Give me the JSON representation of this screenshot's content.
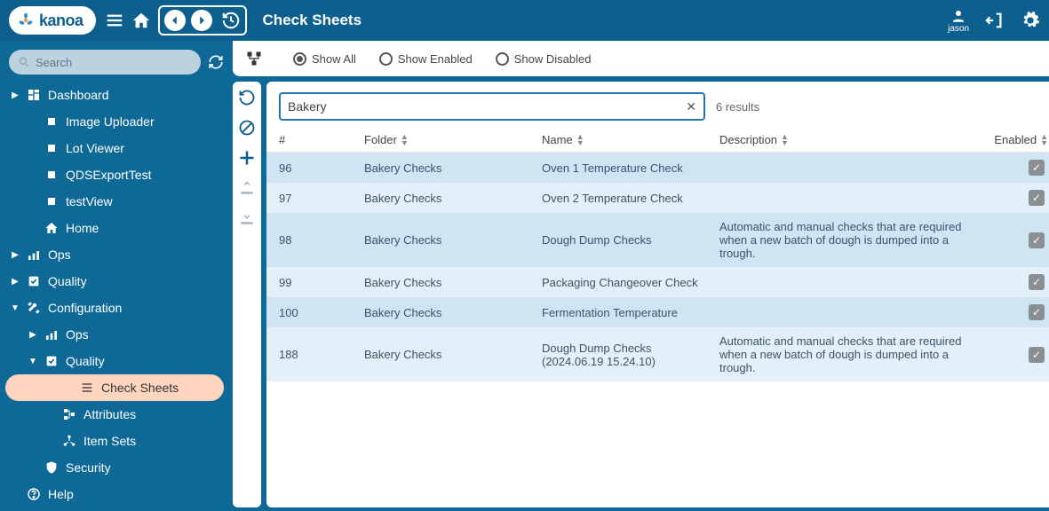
{
  "header": {
    "logo_text": "kanoa",
    "page_title": "Check Sheets",
    "user_name": "jason"
  },
  "sidebar": {
    "search_placeholder": "Search",
    "items": [
      {
        "label": "Dashboard",
        "icon": "dashboard",
        "caret": "right",
        "depth": 0
      },
      {
        "label": "Image Uploader",
        "icon": "square",
        "depth": 1
      },
      {
        "label": "Lot Viewer",
        "icon": "square",
        "depth": 1
      },
      {
        "label": "QDSExportTest",
        "icon": "square",
        "depth": 1
      },
      {
        "label": "testView",
        "icon": "square",
        "depth": 1
      },
      {
        "label": "Home",
        "icon": "home",
        "depth": 1
      },
      {
        "label": "Ops",
        "icon": "ops",
        "caret": "right",
        "depth": 0
      },
      {
        "label": "Quality",
        "icon": "quality",
        "caret": "right",
        "depth": 0
      },
      {
        "label": "Configuration",
        "icon": "tools",
        "caret": "down",
        "depth": 0
      },
      {
        "label": "Ops",
        "icon": "ops",
        "caret": "right",
        "depth": 1
      },
      {
        "label": "Quality",
        "icon": "quality",
        "caret": "down",
        "depth": 1
      },
      {
        "label": "Check Sheets",
        "icon": "checksheet",
        "depth": 2,
        "active": true
      },
      {
        "label": "Attributes",
        "icon": "attributes",
        "depth": 2
      },
      {
        "label": "Item Sets",
        "icon": "itemsets",
        "depth": 2
      },
      {
        "label": "Security",
        "icon": "security",
        "depth": 1
      },
      {
        "label": "Help",
        "icon": "help",
        "depth": 0
      }
    ]
  },
  "filterbar": {
    "options": [
      "Show All",
      "Show Enabled",
      "Show Disabled"
    ],
    "selected": 0
  },
  "panel": {
    "search_value": "Bakery",
    "results_text": "6 results",
    "columns": [
      "#",
      "Folder",
      "Name",
      "Description",
      "Enabled"
    ],
    "rows": [
      {
        "num": "96",
        "folder": "Bakery Checks",
        "name": "Oven 1 Temperature Check",
        "desc": "",
        "enabled": true
      },
      {
        "num": "97",
        "folder": "Bakery Checks",
        "name": "Oven 2 Temperature Check",
        "desc": "",
        "enabled": true
      },
      {
        "num": "98",
        "folder": "Bakery Checks",
        "name": "Dough Dump Checks",
        "desc": "Automatic and manual checks that are required when a new batch of dough is dumped into a trough.",
        "enabled": true
      },
      {
        "num": "99",
        "folder": "Bakery Checks",
        "name": "Packaging Changeover Check",
        "desc": "",
        "enabled": true
      },
      {
        "num": "100",
        "folder": "Bakery Checks",
        "name": "Fermentation Temperature",
        "desc": "",
        "enabled": true
      },
      {
        "num": "188",
        "folder": "Bakery Checks",
        "name": "Dough Dump Checks (2024.06.19 15.24.10)",
        "desc": "Automatic and manual checks that are required when a new batch of dough is dumped into a trough.",
        "enabled": true
      }
    ]
  }
}
